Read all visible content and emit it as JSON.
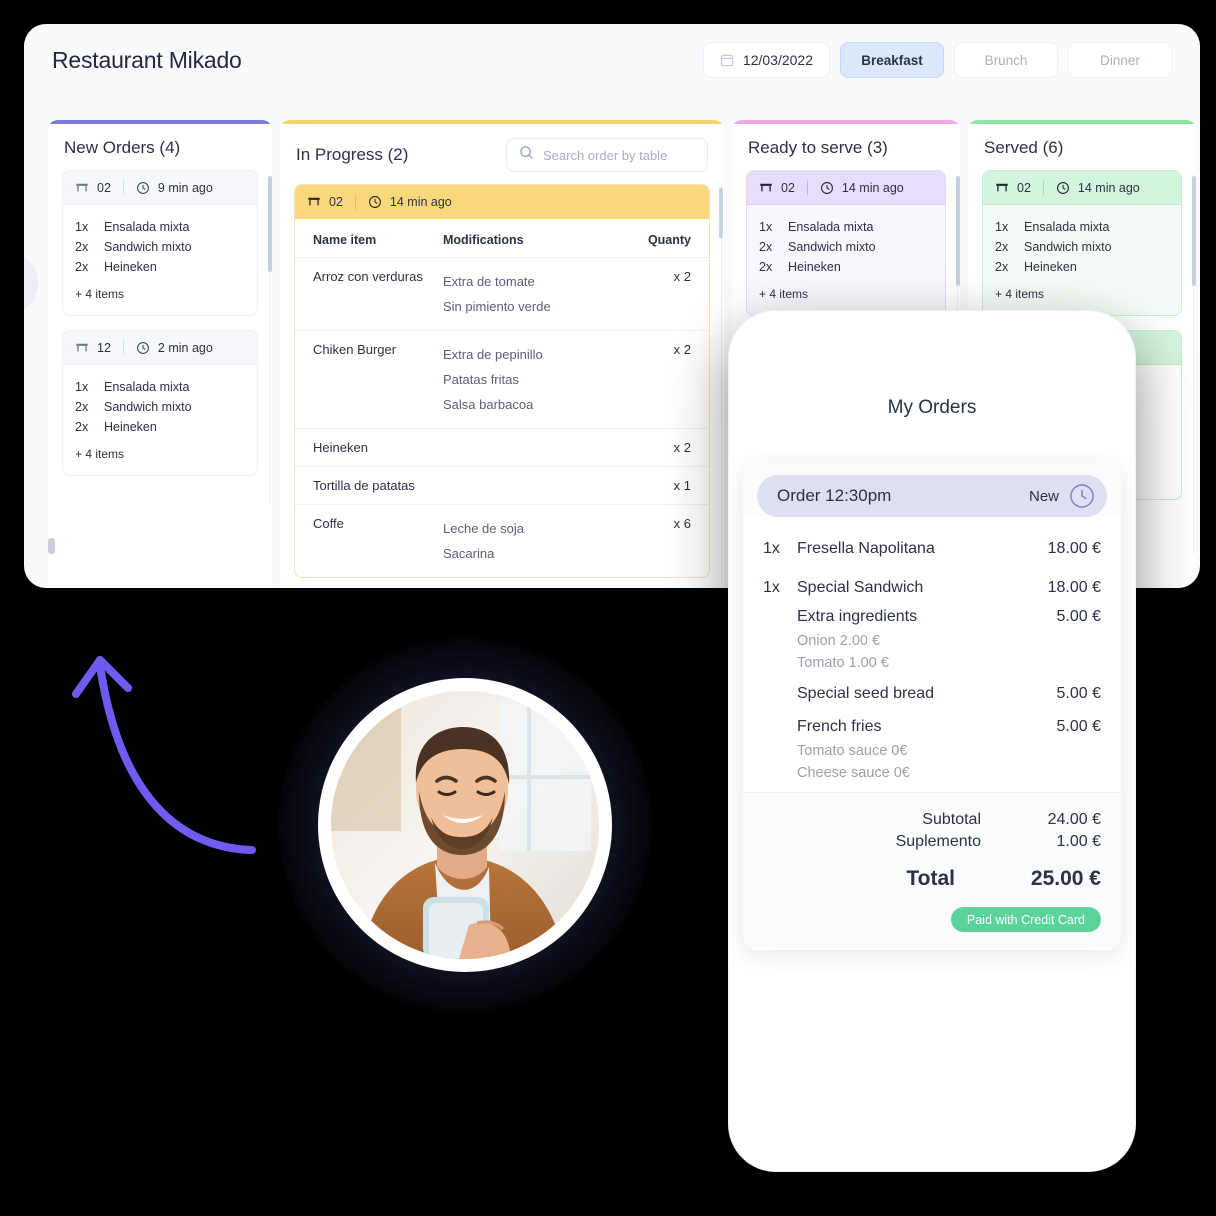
{
  "app": {
    "title": "Restaurant Mikado",
    "date": "12/03/2022",
    "date_icon": "calendar-icon",
    "meal_tabs": [
      {
        "label": "Breakfast",
        "active": true
      },
      {
        "label": "Brunch",
        "active": false
      },
      {
        "label": "Dinner",
        "active": false
      }
    ]
  },
  "search": {
    "placeholder": "Search order by table",
    "value": "",
    "icon": "search-icon"
  },
  "columns": {
    "new_orders": {
      "title": "New Orders (4)",
      "accent": "#7a7cdb",
      "cards": [
        {
          "table": "02",
          "time": "9 min ago",
          "table_icon": "table-icon",
          "clock_icon": "clock-icon",
          "lines": [
            {
              "qty": "1x",
              "name": "Ensalada mixta"
            },
            {
              "qty": "2x",
              "name": "Sandwich mixto"
            },
            {
              "qty": "2x",
              "name": "Heineken"
            }
          ],
          "more": "+ 4 items"
        },
        {
          "table": "12",
          "time": "2 min ago",
          "table_icon": "table-icon",
          "clock_icon": "clock-icon",
          "lines": [
            {
              "qty": "1x",
              "name": "Ensalada mixta"
            },
            {
              "qty": "2x",
              "name": "Sandwich mixto"
            },
            {
              "qty": "2x",
              "name": "Heineken"
            }
          ],
          "more": "+ 4 items"
        }
      ]
    },
    "in_progress": {
      "title": "In Progress (2)",
      "accent": "#f7d46a",
      "card": {
        "table": "02",
        "time": "14 min ago",
        "table_icon": "table-icon",
        "clock_icon": "clock-icon",
        "table_headers": {
          "name": "Name item",
          "modifications": "Modifications",
          "quantity": "Quanty"
        },
        "rows": [
          {
            "name": "Arroz con verduras",
            "mods": [
              "Extra de tomate",
              "Sin pimiento verde"
            ],
            "qty": "x 2"
          },
          {
            "name": "Chiken Burger",
            "mods": [
              "Extra de pepinillo",
              "Patatas fritas",
              "Salsa barbacoa"
            ],
            "qty": "x 2"
          },
          {
            "name": "Heineken",
            "mods": [],
            "qty": "x 2"
          },
          {
            "name": "Tortilla de patatas",
            "mods": [],
            "qty": "x 1"
          },
          {
            "name": "Coffe",
            "mods": [
              "Leche de soja",
              "Sacarina"
            ],
            "qty": "x 6"
          }
        ]
      }
    },
    "ready_to_serve": {
      "title": "Ready to serve (3)",
      "accent": "#f3a8e4",
      "cards": [
        {
          "table": "02",
          "time": "14 min ago",
          "table_icon": "table-icon",
          "clock_icon": "clock-icon",
          "lines": [
            {
              "qty": "1x",
              "name": "Ensalada mixta"
            },
            {
              "qty": "2x",
              "name": "Sandwich mixto"
            },
            {
              "qty": "2x",
              "name": "Heineken"
            }
          ],
          "more": "+ 4 items"
        }
      ]
    },
    "served": {
      "title": "Served (6)",
      "accent": "#8ae59d",
      "cards": [
        {
          "table": "02",
          "time": "14 min ago",
          "table_icon": "table-icon",
          "clock_icon": "clock-icon",
          "lines": [
            {
              "qty": "1x",
              "name": "Ensalada mixta"
            },
            {
              "qty": "2x",
              "name": "Sandwich mixto"
            },
            {
              "qty": "2x",
              "name": "Heineken"
            }
          ],
          "more": "+ 4 items"
        }
      ]
    }
  },
  "phone": {
    "title": "My Orders",
    "order": {
      "label": "Order 12:30pm",
      "status": "New",
      "status_icon": "clock-icon"
    },
    "items": [
      {
        "qty": "1x",
        "name": "Fresella Napolitana",
        "price": "18.00 €",
        "subs": [],
        "notes": []
      },
      {
        "qty": "1x",
        "name": "Special Sandwich",
        "price": "18.00 €",
        "subs": [
          {
            "name": "Extra ingredients",
            "price": "5.00 €"
          }
        ],
        "notes": [
          "Onion 2.00 €",
          "Tomato 1.00 €"
        ]
      },
      {
        "qty": "",
        "name": "Special seed bread",
        "price": "5.00 €",
        "subs": [],
        "notes": [],
        "indent": true
      },
      {
        "qty": "",
        "name": "French fries",
        "price": "5.00 €",
        "subs": [],
        "notes": [
          "Tomato sauce 0€",
          "Cheese sauce 0€"
        ],
        "indent": true
      }
    ],
    "totals": {
      "subtotal_label": "Subtotal",
      "subtotal_value": "24.00 €",
      "supplement_label": "Suplemento",
      "supplement_value": "1.00 €",
      "total_label": "Total",
      "total_value": "25.00 €",
      "paid_badge": "Paid with Credit Card",
      "paid_color": "#5cd39b"
    }
  },
  "decor": {
    "arrow_color": "#6f5bf0",
    "arrow_name": "curved-arrow-up",
    "avatar_name": "person-using-phone-photo"
  }
}
